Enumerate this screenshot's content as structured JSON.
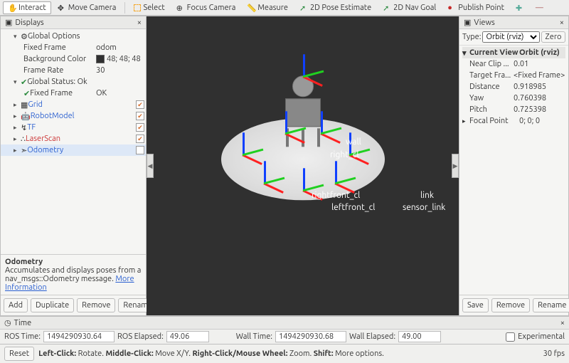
{
  "toolbar": {
    "interact": "Interact",
    "move_camera": "Move Camera",
    "select": "Select",
    "focus_camera": "Focus Camera",
    "measure": "Measure",
    "pose_estimate": "2D Pose Estimate",
    "nav_goal": "2D Nav Goal",
    "publish_point": "Publish Point"
  },
  "displays": {
    "title": "Displays",
    "global_options": "Global Options",
    "fixed_frame_label": "Fixed Frame",
    "fixed_frame_value": "odom",
    "bg_color_label": "Background Color",
    "bg_color_value": "48; 48; 48",
    "frame_rate_label": "Frame Rate",
    "frame_rate_value": "30",
    "global_status": "Global Status: Ok",
    "fixed_frame_status": "Fixed Frame",
    "fixed_frame_status_val": "OK",
    "grid": "Grid",
    "robot_model": "RobotModel",
    "tf": "TF",
    "laserscan": "LaserScan",
    "odometry": "Odometry",
    "desc_title": "Odometry",
    "desc_text": "Accumulates and displays poses from a nav_msgs::Odometry message. ",
    "desc_link": "More Information",
    "add": "Add",
    "duplicate": "Duplicate",
    "remove": "Remove",
    "rename": "Rename"
  },
  "views": {
    "title": "Views",
    "type_label": "Type:",
    "type_value": "Orbit (rviz)",
    "zero": "Zero",
    "current_view": "Current View",
    "current_view_val": "Orbit (rviz)",
    "near_clip": "Near Clip ...",
    "near_clip_val": "0.01",
    "target_frame": "Target Fra...",
    "target_frame_val": "<Fixed Frame>",
    "distance": "Distance",
    "distance_val": "0.918985",
    "yaw": "Yaw",
    "yaw_val": "0.760398",
    "pitch": "Pitch",
    "pitch_val": "0.725398",
    "focal_point": "Focal Point",
    "focal_point_val": "0; 0; 0",
    "save": "Save",
    "remove": "Remove",
    "rename": "Rename"
  },
  "viewport_labels": {
    "l1": "wall",
    "l2": "right_cl",
    "l3": "rightfront_cl",
    "l4": "leftfront_cl",
    "l5": "link",
    "l6": "sensor_link"
  },
  "time": {
    "title": "Time",
    "ros_time_label": "ROS Time:",
    "ros_time": "1494290930.64",
    "ros_elapsed_label": "ROS Elapsed:",
    "ros_elapsed": "49.06",
    "wall_time_label": "Wall Time:",
    "wall_time": "1494290930.68",
    "wall_elapsed_label": "Wall Elapsed:",
    "wall_elapsed": "49.00",
    "experimental": "Experimental"
  },
  "status": {
    "reset": "Reset",
    "hint_1": "Left-Click:",
    "hint_1v": " Rotate. ",
    "hint_2": "Middle-Click:",
    "hint_2v": " Move X/Y. ",
    "hint_3": "Right-Click/Mouse Wheel:",
    "hint_3v": " Zoom. ",
    "hint_4": "Shift:",
    "hint_4v": " More options.",
    "fps": "30 fps"
  }
}
